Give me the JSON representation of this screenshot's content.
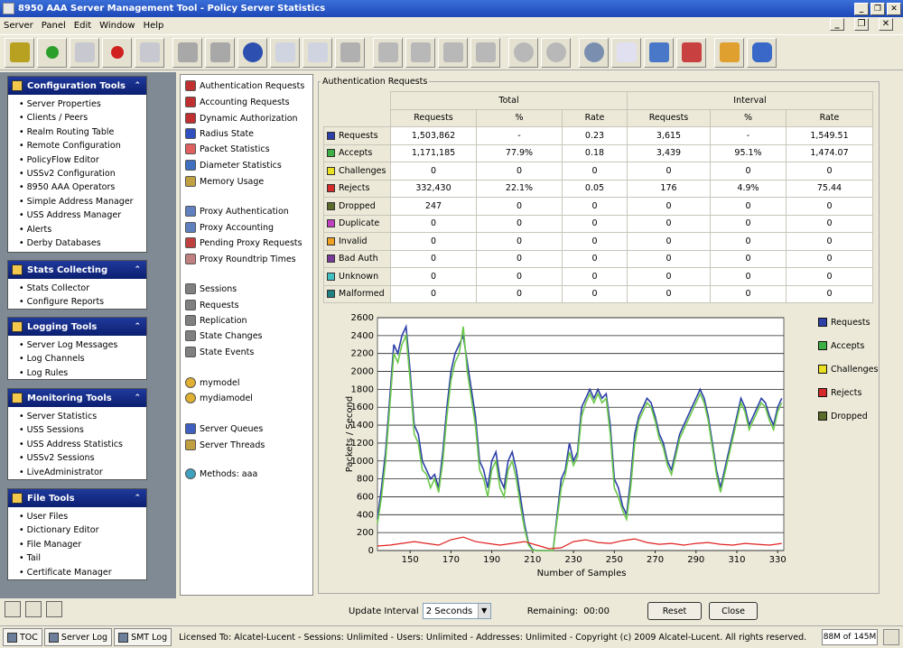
{
  "window": {
    "title": "8950 AAA Server Management Tool - Policy Server Statistics"
  },
  "menu": [
    "Server",
    "Panel",
    "Edit",
    "Window",
    "Help"
  ],
  "sections": [
    {
      "title": "Configuration Tools",
      "items": [
        "Server Properties",
        "Clients / Peers",
        "Realm Routing Table",
        "Remote Configuration",
        "PolicyFlow Editor",
        "USSv2 Configuration",
        "8950 AAA Operators",
        "Simple Address Manager",
        "USS Address Manager",
        "Alerts",
        "Derby Databases"
      ]
    },
    {
      "title": "Stats Collecting",
      "items": [
        "Stats Collector",
        "Configure Reports"
      ]
    },
    {
      "title": "Logging Tools",
      "items": [
        "Server Log Messages",
        "Log Channels",
        "Log Rules"
      ]
    },
    {
      "title": "Monitoring Tools",
      "items": [
        "Server Statistics",
        "USS Sessions",
        "USS Address Statistics",
        "USSv2 Sessions",
        "LiveAdministrator"
      ]
    },
    {
      "title": "File Tools",
      "items": [
        "User Files",
        "Dictionary Editor",
        "File Manager",
        "Tail",
        "Certificate Manager"
      ]
    }
  ],
  "nav": {
    "group1": [
      "Authentication Requests",
      "Accounting Requests",
      "Dynamic Authorization",
      "Radius State",
      "Packet Statistics",
      "Diameter Statistics",
      "Memory Usage"
    ],
    "group2": [
      "Proxy Authentication",
      "Proxy Accounting",
      "Pending Proxy Requests",
      "Proxy Roundtrip Times"
    ],
    "group3": [
      "Sessions",
      "Requests",
      "Replication",
      "State Changes",
      "State Events"
    ],
    "group4": [
      "mymodel",
      "mydiamodel"
    ],
    "group5": [
      "Server Queues",
      "Server Threads"
    ],
    "group6": [
      "Methods: aaa"
    ]
  },
  "stats": {
    "group_label": "Authentication Requests",
    "total_label": "Total",
    "interval_label": "Interval",
    "columns": [
      "Requests",
      "%",
      "Rate",
      "Requests",
      "%",
      "Rate"
    ],
    "rows": [
      {
        "label": "Requests",
        "color": "#2d3fa8",
        "values": [
          "1,503,862",
          "-",
          "0.23",
          "3,615",
          "-",
          "1,549.51"
        ]
      },
      {
        "label": "Accepts",
        "color": "#3cb043",
        "values": [
          "1,171,185",
          "77.9%",
          "0.18",
          "3,439",
          "95.1%",
          "1,474.07"
        ]
      },
      {
        "label": "Challenges",
        "color": "#e8e020",
        "values": [
          "0",
          "0",
          "0",
          "0",
          "0",
          "0"
        ]
      },
      {
        "label": "Rejects",
        "color": "#d42a2a",
        "values": [
          "332,430",
          "22.1%",
          "0.05",
          "176",
          "4.9%",
          "75.44"
        ]
      },
      {
        "label": "Dropped",
        "color": "#5a6b2a",
        "values": [
          "247",
          "0",
          "0",
          "0",
          "0",
          "0"
        ]
      },
      {
        "label": "Duplicate",
        "color": "#c040c0",
        "values": [
          "0",
          "0",
          "0",
          "0",
          "0",
          "0"
        ]
      },
      {
        "label": "Invalid",
        "color": "#f0a020",
        "values": [
          "0",
          "0",
          "0",
          "0",
          "0",
          "0"
        ]
      },
      {
        "label": "Bad Auth",
        "color": "#7a3a9a",
        "values": [
          "0",
          "0",
          "0",
          "0",
          "0",
          "0"
        ]
      },
      {
        "label": "Unknown",
        "color": "#40c0c0",
        "values": [
          "0",
          "0",
          "0",
          "0",
          "0",
          "0"
        ]
      },
      {
        "label": "Malformed",
        "color": "#208080",
        "values": [
          "0",
          "0",
          "0",
          "0",
          "0",
          "0"
        ]
      }
    ]
  },
  "chart_data": {
    "type": "line",
    "xlabel": "Number of Samples",
    "ylabel": "Packets / Second",
    "xlim": [
      134,
      333
    ],
    "ylim": [
      0,
      2600
    ],
    "xticks": [
      150,
      170,
      190,
      210,
      230,
      250,
      270,
      290,
      310,
      330
    ],
    "yticks": [
      0,
      200,
      400,
      600,
      800,
      1000,
      1200,
      1400,
      1600,
      1800,
      2000,
      2200,
      2400,
      2600
    ],
    "legend": [
      "Requests",
      "Accepts",
      "Challenges",
      "Rejects",
      "Dropped"
    ],
    "colors": {
      "Requests": "#2d3fa8",
      "Accepts": "#6cc94a",
      "Challenges": "#e8e020",
      "Rejects": "#e02020",
      "Dropped": "#4a5a20"
    },
    "series": [
      {
        "name": "Requests",
        "x": [
          134,
          136,
          138,
          140,
          142,
          144,
          146,
          148,
          150,
          152,
          154,
          156,
          158,
          160,
          162,
          164,
          166,
          168,
          170,
          172,
          174,
          176,
          178,
          180,
          182,
          184,
          186,
          188,
          190,
          192,
          194,
          196,
          198,
          200,
          202,
          204,
          206,
          208,
          210,
          212,
          214,
          216,
          218,
          220,
          222,
          224,
          226,
          228,
          230,
          232,
          234,
          236,
          238,
          240,
          242,
          244,
          246,
          248,
          250,
          252,
          254,
          256,
          258,
          260,
          262,
          264,
          266,
          268,
          270,
          272,
          274,
          276,
          278,
          280,
          282,
          284,
          286,
          288,
          290,
          292,
          294,
          296,
          298,
          300,
          302,
          304,
          306,
          308,
          310,
          312,
          314,
          316,
          318,
          320,
          322,
          324,
          326,
          328,
          330,
          332
        ],
        "y": [
          350,
          700,
          1100,
          1700,
          2300,
          2200,
          2400,
          2500,
          2000,
          1400,
          1300,
          1000,
          900,
          800,
          850,
          700,
          1100,
          1600,
          2000,
          2200,
          2300,
          2400,
          2100,
          1800,
          1500,
          1000,
          900,
          700,
          1000,
          1100,
          800,
          700,
          1000,
          1100,
          900,
          600,
          300,
          80,
          10,
          0,
          0,
          0,
          0,
          0,
          400,
          800,
          900,
          1200,
          1000,
          1100,
          1600,
          1700,
          1800,
          1700,
          1800,
          1700,
          1750,
          1400,
          800,
          700,
          500,
          400,
          800,
          1300,
          1500,
          1600,
          1700,
          1650,
          1500,
          1300,
          1200,
          1000,
          900,
          1100,
          1300,
          1400,
          1500,
          1600,
          1700,
          1800,
          1700,
          1500,
          1200,
          900,
          700,
          900,
          1100,
          1300,
          1500,
          1700,
          1600,
          1400,
          1500,
          1600,
          1700,
          1650,
          1500,
          1400,
          1600,
          1700
        ]
      },
      {
        "name": "Accepts",
        "x": [
          134,
          136,
          138,
          140,
          142,
          144,
          146,
          148,
          150,
          152,
          154,
          156,
          158,
          160,
          162,
          164,
          166,
          168,
          170,
          172,
          174,
          176,
          178,
          180,
          182,
          184,
          186,
          188,
          190,
          192,
          194,
          196,
          198,
          200,
          202,
          204,
          206,
          208,
          210,
          212,
          214,
          216,
          218,
          220,
          222,
          224,
          226,
          228,
          230,
          232,
          234,
          236,
          238,
          240,
          242,
          244,
          246,
          248,
          250,
          252,
          254,
          256,
          258,
          260,
          262,
          264,
          266,
          268,
          270,
          272,
          274,
          276,
          278,
          280,
          282,
          284,
          286,
          288,
          290,
          292,
          294,
          296,
          298,
          300,
          302,
          304,
          306,
          308,
          310,
          312,
          314,
          316,
          318,
          320,
          322,
          324,
          326,
          328,
          330,
          332
        ],
        "y": [
          300,
          600,
          1000,
          1600,
          2200,
          2100,
          2300,
          2400,
          1900,
          1300,
          1200,
          900,
          850,
          700,
          800,
          650,
          1000,
          1500,
          1900,
          2100,
          2200,
          2500,
          2000,
          1700,
          1400,
          900,
          800,
          600,
          900,
          1000,
          700,
          600,
          900,
          1000,
          800,
          500,
          250,
          60,
          5,
          0,
          0,
          0,
          0,
          0,
          350,
          700,
          850,
          1100,
          950,
          1050,
          1500,
          1650,
          1750,
          1650,
          1750,
          1650,
          1700,
          1300,
          700,
          600,
          450,
          350,
          700,
          1200,
          1450,
          1550,
          1650,
          1600,
          1450,
          1250,
          1150,
          950,
          850,
          1050,
          1250,
          1350,
          1450,
          1550,
          1650,
          1750,
          1650,
          1450,
          1150,
          850,
          650,
          850,
          1050,
          1250,
          1450,
          1650,
          1550,
          1350,
          1450,
          1550,
          1650,
          1600,
          1450,
          1350,
          1550,
          1650
        ]
      },
      {
        "name": "Rejects",
        "x": [
          134,
          140,
          146,
          152,
          158,
          164,
          170,
          176,
          182,
          188,
          194,
          200,
          206,
          212,
          218,
          224,
          230,
          236,
          242,
          248,
          254,
          260,
          266,
          272,
          278,
          284,
          290,
          296,
          302,
          308,
          314,
          320,
          326,
          332
        ],
        "y": [
          50,
          60,
          80,
          100,
          80,
          60,
          120,
          150,
          100,
          80,
          60,
          80,
          100,
          60,
          20,
          30,
          100,
          120,
          90,
          80,
          110,
          130,
          90,
          70,
          80,
          60,
          80,
          90,
          70,
          60,
          80,
          70,
          60,
          80
        ]
      }
    ]
  },
  "controls": {
    "update_label": "Update Interval",
    "update_value": "2 Seconds",
    "remaining_label": "Remaining:",
    "remaining_value": "00:00",
    "reset": "Reset",
    "close": "Close"
  },
  "status": {
    "tabs": [
      "TOC",
      "Server Log",
      "SMT Log"
    ],
    "license": "Licensed To: Alcatel-Lucent - Sessions: Unlimited - Users: Unlimited - Addresses: Unlimited - Copyright (c) 2009 Alcatel-Lucent. All rights reserved.",
    "memory": "88M of 145M"
  }
}
